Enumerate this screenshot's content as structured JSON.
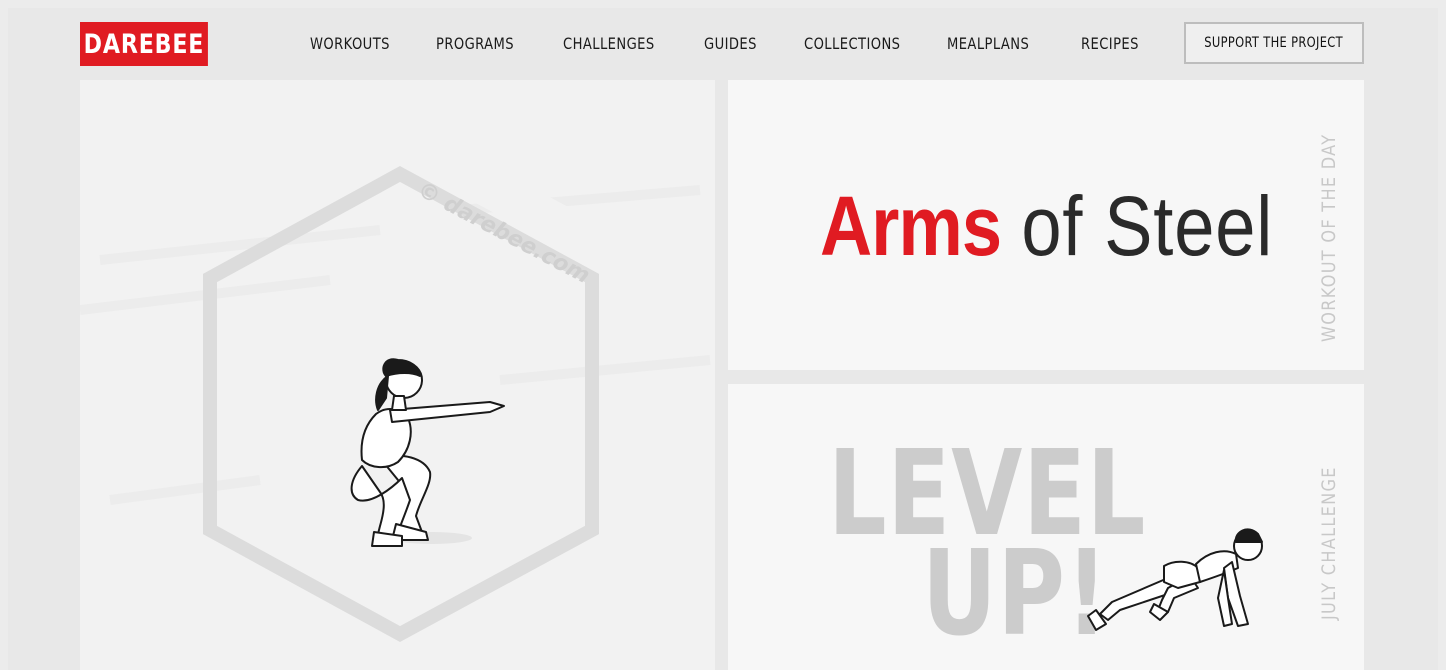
{
  "brand": {
    "logo_text": "DAREBEE",
    "accent_color": "#e01b22"
  },
  "nav": {
    "items": [
      {
        "label": "WORKOUTS"
      },
      {
        "label": "PROGRAMS"
      },
      {
        "label": "CHALLENGES"
      },
      {
        "label": "GUIDES"
      },
      {
        "label": "COLLECTIONS"
      },
      {
        "label": "MEALPLANS"
      },
      {
        "label": "RECIPES"
      }
    ],
    "support_label": "SUPPORT THE PROJECT"
  },
  "hero": {
    "watermark": "© darebee.com",
    "illustration": "squat-figure"
  },
  "workout_of_the_day": {
    "title_accent": "Arms",
    "title_rest": "of Steel",
    "side_label": "WORKOUT OF THE DAY"
  },
  "challenge": {
    "title_line1": "LEVEL",
    "title_line2": "UP!",
    "side_label": "JULY CHALLENGE",
    "illustration": "mountain-climber-figure"
  }
}
